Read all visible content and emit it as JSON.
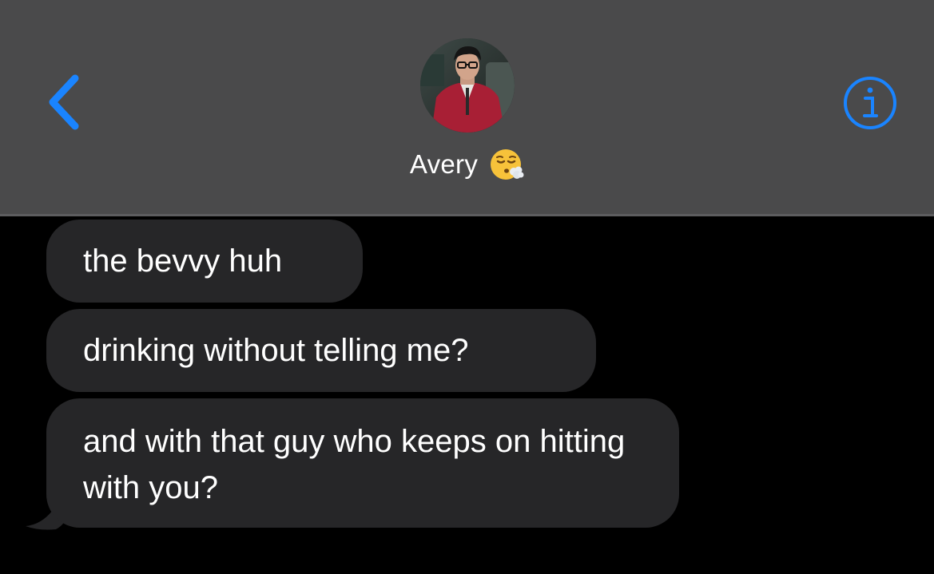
{
  "header": {
    "back_icon": "chevron-left-icon",
    "info_icon": "info-circle-icon",
    "accent_color": "#1a84ff",
    "background_color": "#4a4a4b",
    "contact": {
      "name": "Avery",
      "status_emoji": "😮‍💨",
      "avatar_icon": "contact-photo"
    }
  },
  "conversation": {
    "bubble_color": "#262628",
    "background_color": "#000000",
    "messages": [
      {
        "direction": "incoming",
        "text": "the bevvy huh"
      },
      {
        "direction": "incoming",
        "text": "drinking without telling me?"
      },
      {
        "direction": "incoming",
        "text": "and with that guy who keeps on hitting with you?"
      }
    ]
  }
}
